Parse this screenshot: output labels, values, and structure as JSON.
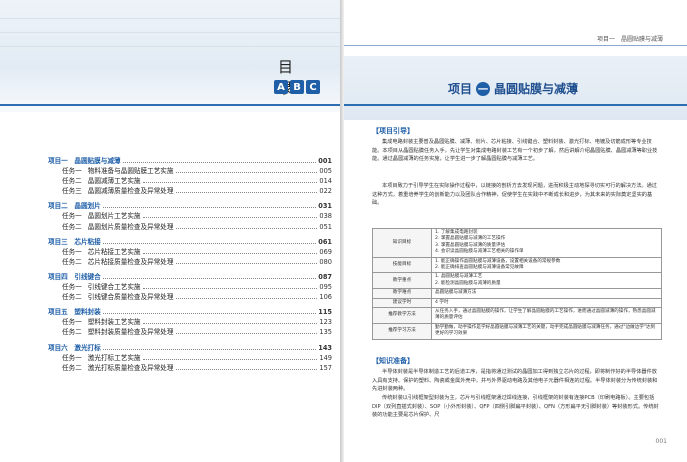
{
  "left": {
    "title": "目 录",
    "letters": [
      "A",
      "B",
      "C"
    ],
    "toc": [
      {
        "type": "project",
        "label": "项目一　晶圆贴膜与减薄",
        "page": "001"
      },
      {
        "type": "task",
        "num": "任务一",
        "label": "物料准备与晶圆贴膜工艺实施",
        "page": "005"
      },
      {
        "type": "task",
        "num": "任务二",
        "label": "晶圆减薄工艺实施",
        "page": "014"
      },
      {
        "type": "task",
        "num": "任务三",
        "label": "晶圆减薄质量检查及异常处理",
        "page": "022"
      },
      {
        "type": "project",
        "label": "项目二　晶圆划片",
        "page": "031"
      },
      {
        "type": "task",
        "num": "任务一",
        "label": "晶圆划片工艺实施",
        "page": "038"
      },
      {
        "type": "task",
        "num": "任务二",
        "label": "晶圆划片质量检查及异常处理",
        "page": "051"
      },
      {
        "type": "project",
        "label": "项目三　芯片粘接",
        "page": "061"
      },
      {
        "type": "task",
        "num": "任务一",
        "label": "芯片粘接工艺实施",
        "page": "069"
      },
      {
        "type": "task",
        "num": "任务二",
        "label": "芯片粘接质量检查及异常处理",
        "page": "080"
      },
      {
        "type": "project",
        "label": "项目四　引线键合",
        "page": "087"
      },
      {
        "type": "task",
        "num": "任务一",
        "label": "引线键合工艺实施",
        "page": "095"
      },
      {
        "type": "task",
        "num": "任务二",
        "label": "引线键合质量检查及异常处理",
        "page": "106"
      },
      {
        "type": "project",
        "label": "项目五　塑料封装",
        "page": "115"
      },
      {
        "type": "task",
        "num": "任务一",
        "label": "塑料封装工艺实施",
        "page": "123"
      },
      {
        "type": "task",
        "num": "任务二",
        "label": "塑料封装质量检查及异常处理",
        "page": "135"
      },
      {
        "type": "project",
        "label": "项目六　激光打标",
        "page": "143"
      },
      {
        "type": "task",
        "num": "任务一",
        "label": "激光打标工艺实施",
        "page": "149"
      },
      {
        "type": "task",
        "num": "任务二",
        "label": "激光打标质量检查及异常处理",
        "page": "157"
      }
    ]
  },
  "right": {
    "running_head": "项目一　晶圆贴膜与减薄",
    "project_prefix": "项目",
    "project_num": "一",
    "project_title": "晶圆贴膜与减薄",
    "sec1": "【项目引导】",
    "para1": "集成电路封装主要普及晶圆贴膜、减薄、划片、芯片粘接、引线键合、塑料封装、激光打标、电镀及切筋成形等专业技能。本项目从晶圆贴膜任务入手，先让学生对集成电路封装工艺有一个初步了解，然后讲解介绍晶圆贴膜、晶圆减薄等职业技能。通过晶圆减薄的任务实施，让学生进一步了解晶圆贴膜与减薄工艺。",
    "para2": "本项目致力于引导学生在实际操作过程中，以链接的剖析方去发现问题，进而积极主动地探寻切实可行的解决方法。通过这种方式，着重培养学生的创新能力以及团队合作精神，促使学生在实践中不断成长和进步，为其未来的实际奠定坚实的基础。",
    "table": [
      {
        "k": "知识目标",
        "v": [
          "1. 了解集成电路封装",
          "2. 掌握晶圆贴膜与减薄的工艺操作",
          "3. 掌握晶圆贴膜与减薄的质量评估",
          "4. 会识读晶圆贴膜与减薄工艺相关的操作单"
        ]
      },
      {
        "k": "技能目标",
        "v": [
          "1. 能正确操作晶圆贴膜与减薄设备，设置相关设备的常规参数",
          "2. 能正确排查晶圆贴膜与减薄设备常见故障"
        ]
      },
      {
        "k": "教学重点",
        "v": [
          "1. 晶圆贴膜与减薄工艺",
          "2. 能检测晶圆贴膜与减薄的质量"
        ]
      },
      {
        "k": "教学难点",
        "v": [
          "晶圆贴膜与减薄方法"
        ]
      },
      {
        "k": "建议学时",
        "v": [
          "4 学时"
        ]
      },
      {
        "k": "推荐教学方法",
        "v": [
          "从任务入手，通过晶圆贴膜的操作，让学生了解晶圆贴膜的工艺操作，进而通过晶圆减薄的操作，熟悉晶圆减薄的质量评估"
        ]
      },
      {
        "k": "推荐学习方法",
        "v": [
          "勤学勤做，动手操作是学好晶圆贴膜与减薄工艺的关键，动手完成晶圆贴膜与减薄任务，通过\"边做边学\"达到更好的学习效果"
        ]
      }
    ],
    "sec2": "【知识准备】",
    "para3": "半导体封装是半导体制造工艺的后道工序，是指将通过测试的晶圆加工得到独立芯片的过程，即将制作好的半导体器件放入具有支持、保护的塑料、陶瓷或金属外壳中，并与外界驱动电路及其他电子元器件相连的过程。半导体封装分为传统封装和先进封装两种。",
    "para4": "传统封装以引线框架型封装为主，芯片与引线框架通过焊线连接，引线框架的封装有连接PCB（印刷电路板）。主要包括DIP（双列直插式封装）、SOP（小外形封装）、QFP（四侧引脚扁平封装）、QFN（方形扁平无引脚封装）等封装形式。传统封装的功能主要是芯片保护、尺",
    "page_num": "001"
  }
}
